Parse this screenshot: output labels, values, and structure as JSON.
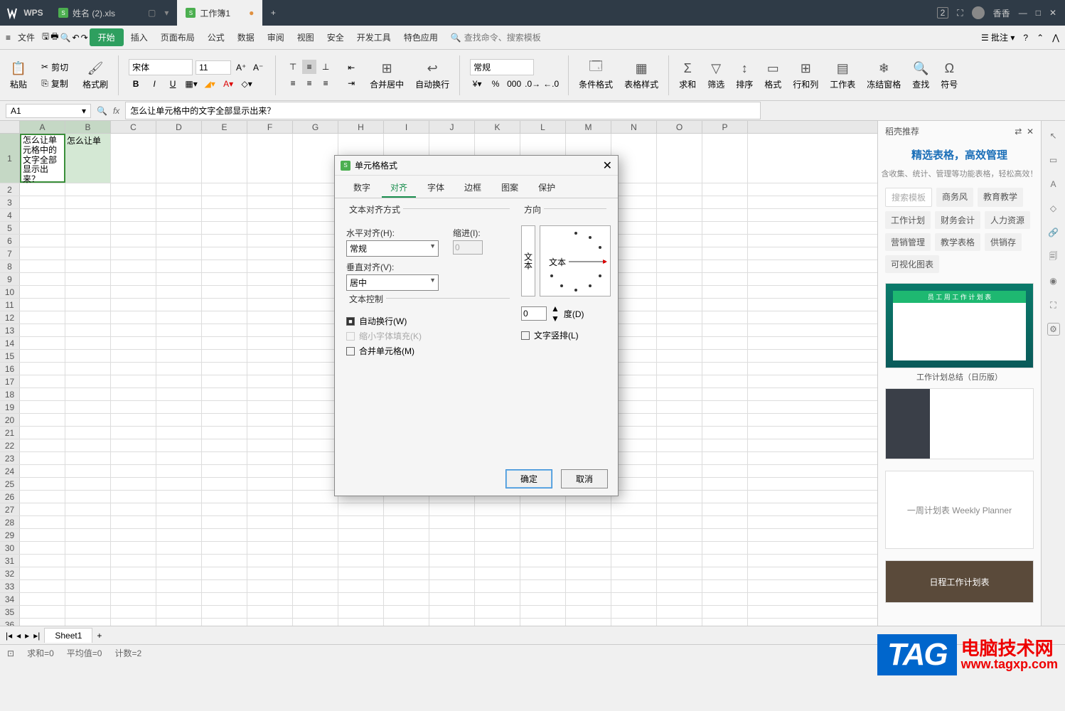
{
  "titlebar": {
    "app": "WPS",
    "tab1": "姓名 (2).xls",
    "tab2": "工作簿1",
    "user": "香香"
  },
  "menubar": {
    "file": "文件",
    "start": "开始",
    "insert": "插入",
    "layout": "页面布局",
    "formula": "公式",
    "data": "数据",
    "review": "审阅",
    "view": "视图",
    "safe": "安全",
    "dev": "开发工具",
    "special": "特色应用",
    "search": "查找命令、搜索模板",
    "annotate": "批注"
  },
  "ribbon": {
    "paste": "粘贴",
    "cut": "剪切",
    "copy": "复制",
    "painter": "格式刷",
    "font": "宋体",
    "size": "11",
    "merge": "合并居中",
    "wrap": "自动换行",
    "numfmt": "常规",
    "cond": "条件格式",
    "tblstyle": "表格样式",
    "sum": "求和",
    "filter": "筛选",
    "sort": "排序",
    "fmt": "格式",
    "rowcol": "行和列",
    "sheet": "工作表",
    "freeze": "冻结窗格",
    "find": "查找",
    "sym": "符号"
  },
  "addr": {
    "cell": "A1",
    "formula": "怎么让单元格中的文字全部显示出来？"
  },
  "cells": {
    "A1": "怎么让单元格中的文字全部显示出来？",
    "B1": "怎么让单"
  },
  "sheet": {
    "name": "Sheet1"
  },
  "status": {
    "sum": "求和=0",
    "avg": "平均值=0",
    "count": "计数=2"
  },
  "side": {
    "head": "稻壳推荐",
    "title": "精选表格，高效管理",
    "sub": "含收集、统计、管理等功能表格，轻松高效！",
    "tags": {
      "search": "搜索模板",
      "biz": "商务风",
      "edu": "教育教学",
      "plan": "工作计划",
      "fin": "财务会计",
      "hr": "人力资源",
      "mkt": "营销管理",
      "teach": "教学表格",
      "sale": "供销存",
      "viz": "可视化图表"
    },
    "tmpl1": "员 工 周 工 作 计 划 表",
    "tmpl2": "工作计划总结（日历版）",
    "tmpl3": "一周计划表 Weekly Planner",
    "tmpl4": "日程工作计划表"
  },
  "dialog": {
    "title": "单元格格式",
    "tabs": {
      "num": "数字",
      "align": "对齐",
      "font": "字体",
      "border": "边框",
      "pattern": "图案",
      "protect": "保护"
    },
    "txtAlign": "文本对齐方式",
    "hAlign": "水平对齐(H):",
    "hVal": "常规",
    "indent": "缩进(I):",
    "indentVal": "0",
    "vAlign": "垂直对齐(V):",
    "vVal": "居中",
    "txtCtrl": "文本控制",
    "wrap": "自动换行(W)",
    "shrink": "缩小字体填充(K)",
    "mergeC": "合并单元格(M)",
    "orient": "方向",
    "orientTxt": "文本",
    "deg": "度(D)",
    "degVal": "0",
    "vert": "文字竖排(L)",
    "ok": "确定",
    "cancel": "取消"
  },
  "watermark": {
    "cn": "电脑技术网",
    "url": "www.tagxp.com"
  }
}
